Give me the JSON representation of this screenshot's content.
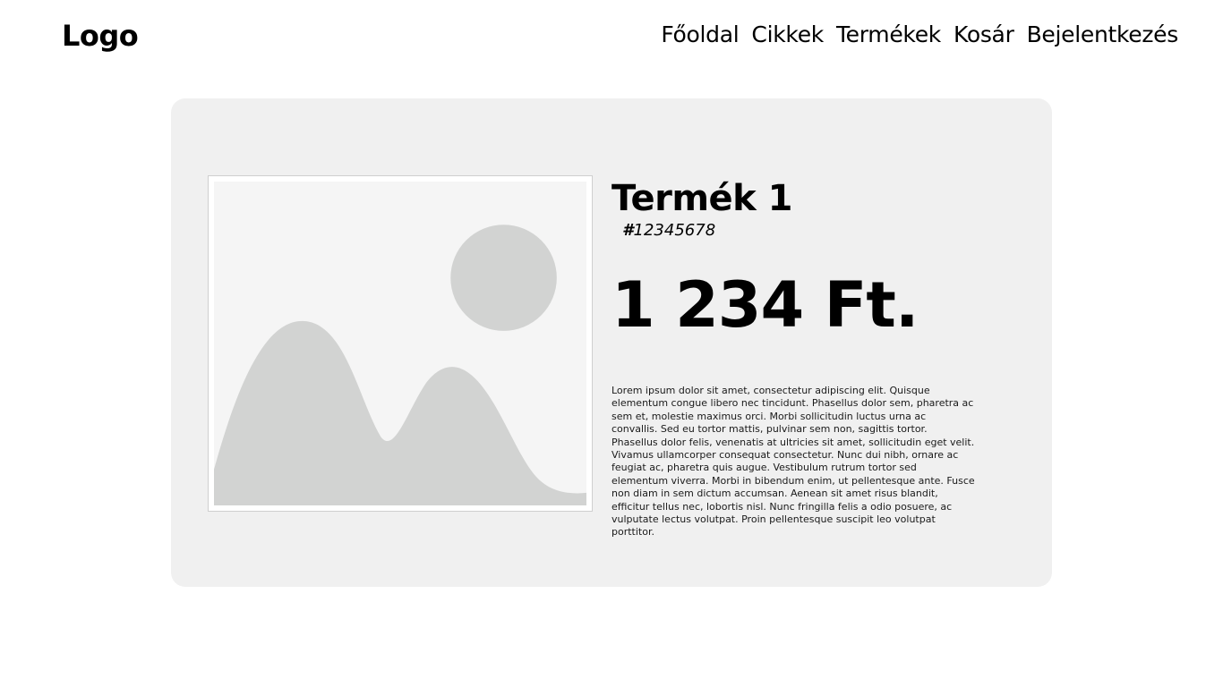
{
  "header": {
    "logo": "Logo",
    "nav": [
      "Főoldal",
      "Cikkek",
      "Termékek",
      "Kosár",
      "Bejelentkezés"
    ]
  },
  "product": {
    "title": "Termék 1",
    "sku_prefix": "#",
    "sku": "12345678",
    "price": "1 234 Ft.",
    "description": "Lorem ipsum dolor sit amet, consectetur adipiscing elit. Quisque elementum congue libero nec tincidunt. Phasellus dolor sem, pharetra ac sem et, molestie maximus orci. Morbi sollicitudin luctus urna ac convallis. Sed eu tortor mattis, pulvinar sem non, sagittis tortor. Phasellus dolor felis, venenatis at ultricies sit amet, sollicitudin eget velit. Vivamus ullamcorper consequat consectetur. Nunc dui nibh, ornare ac feugiat ac, pharetra quis augue. Vestibulum rutrum tortor sed elementum viverra. Morbi in bibendum enim, ut pellentesque ante. Fusce non diam in sem dictum accumsan. Aenean sit amet risus blandit, efficitur tellus nec, lobortis nisl. Nunc fringilla felis a odio posuere, ac vulputate lectus volutpat. Proin pellentesque suscipit leo volutpat porttitor.",
    "image_icon": "image-placeholder-icon"
  },
  "colors": {
    "card_background": "#f0f0f0",
    "image_background": "#f5f5f5",
    "placeholder_shapes": "#d2d3d2"
  }
}
